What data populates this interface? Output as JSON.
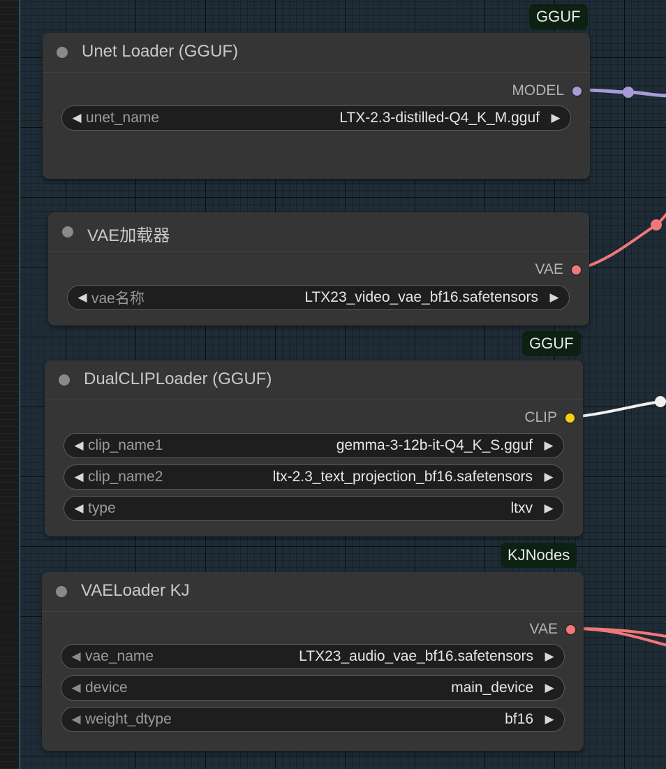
{
  "colors": {
    "model": "#a99ad8",
    "vae": "#f07878",
    "clip": "#f5d20a",
    "badge_bg": "#0c2112"
  },
  "nodes": {
    "unet_loader": {
      "title": "Unet Loader (GGUF)",
      "badge": "GGUF",
      "output": "MODEL",
      "widgets": [
        {
          "label": "unet_name",
          "value": "LTX-2.3-distilled-Q4_K_M.gguf"
        }
      ]
    },
    "vae_loader": {
      "title": "VAE加载器",
      "output": "VAE",
      "widgets": [
        {
          "label": "vae名称",
          "value": "LTX23_video_vae_bf16.safetensors"
        }
      ]
    },
    "dual_clip_loader": {
      "title": "DualCLIPLoader (GGUF)",
      "badge": "GGUF",
      "output": "CLIP",
      "widgets": [
        {
          "label": "clip_name1",
          "value": "gemma-3-12b-it-Q4_K_S.gguf"
        },
        {
          "label": "clip_name2",
          "value": "ltx-2.3_text_projection_bf16.safetensors"
        },
        {
          "label": "type",
          "value": "ltxv"
        }
      ]
    },
    "vae_loader_kj": {
      "title": "VAELoader KJ",
      "badge": "KJNodes",
      "output": "VAE",
      "widgets": [
        {
          "label": "vae_name",
          "value": "LTX23_audio_vae_bf16.safetensors"
        },
        {
          "label": "device",
          "value": "main_device"
        },
        {
          "label": "weight_dtype",
          "value": "bf16"
        }
      ]
    }
  },
  "icons": {
    "left_arrow": "triangle-left",
    "right_arrow": "triangle-right",
    "status_dot": "circle"
  }
}
